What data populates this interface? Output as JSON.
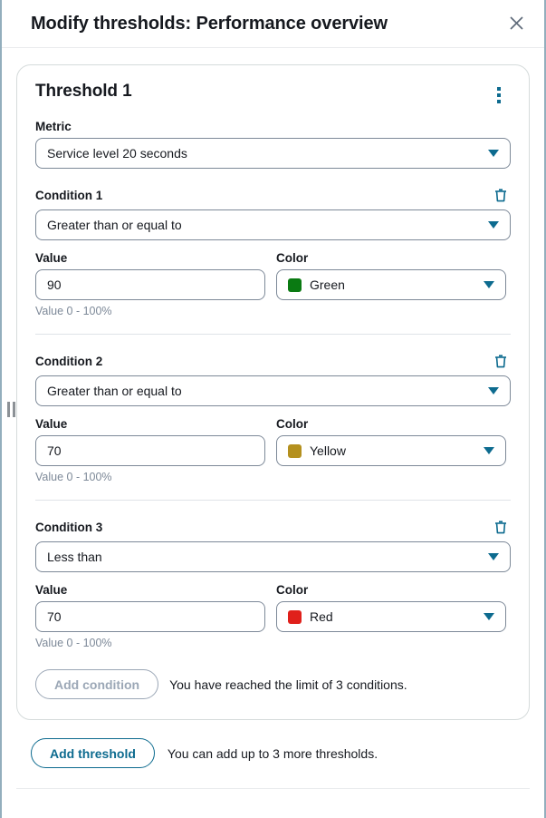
{
  "header": {
    "title": "Modify thresholds: Performance overview",
    "close_icon": "close-icon"
  },
  "drag_handle": {
    "icon": "drag-handle-icon"
  },
  "colors": {
    "accent": "#0d6b8f",
    "panel_border": "#93aebd",
    "card_border": "#d5dbdb",
    "input_border": "#7d8998",
    "hint_text": "#7d8998",
    "disabled": "#9ba7b6",
    "green": "#0a7a12",
    "yellow": "#b4901e",
    "red": "#e0201b"
  },
  "threshold": {
    "title": "Threshold 1",
    "menu_icon": "kebab-menu-icon",
    "metric": {
      "label": "Metric",
      "value": "Service level 20 seconds"
    },
    "conditions": [
      {
        "label": "Condition 1",
        "delete_icon": "trash-icon",
        "operator": "Greater than or equal to",
        "value_label": "Value",
        "value": "90",
        "value_hint": "Value 0 - 100%",
        "color_label": "Color",
        "color_name": "Green",
        "color_hex": "#0a7a12"
      },
      {
        "label": "Condition 2",
        "delete_icon": "trash-icon",
        "operator": "Greater than or equal to",
        "value_label": "Value",
        "value": "70",
        "value_hint": "Value 0 - 100%",
        "color_label": "Color",
        "color_name": "Yellow",
        "color_hex": "#b4901e"
      },
      {
        "label": "Condition 3",
        "delete_icon": "trash-icon",
        "operator": "Less than",
        "value_label": "Value",
        "value": "70",
        "value_hint": "Value 0 - 100%",
        "color_label": "Color",
        "color_name": "Red",
        "color_hex": "#e0201b"
      }
    ],
    "add_condition": {
      "label": "Add condition",
      "note": "You have reached the limit of 3 conditions.",
      "disabled": true
    }
  },
  "footer": {
    "add_threshold": {
      "label": "Add threshold",
      "note": "You can add up to 3 more thresholds."
    }
  }
}
